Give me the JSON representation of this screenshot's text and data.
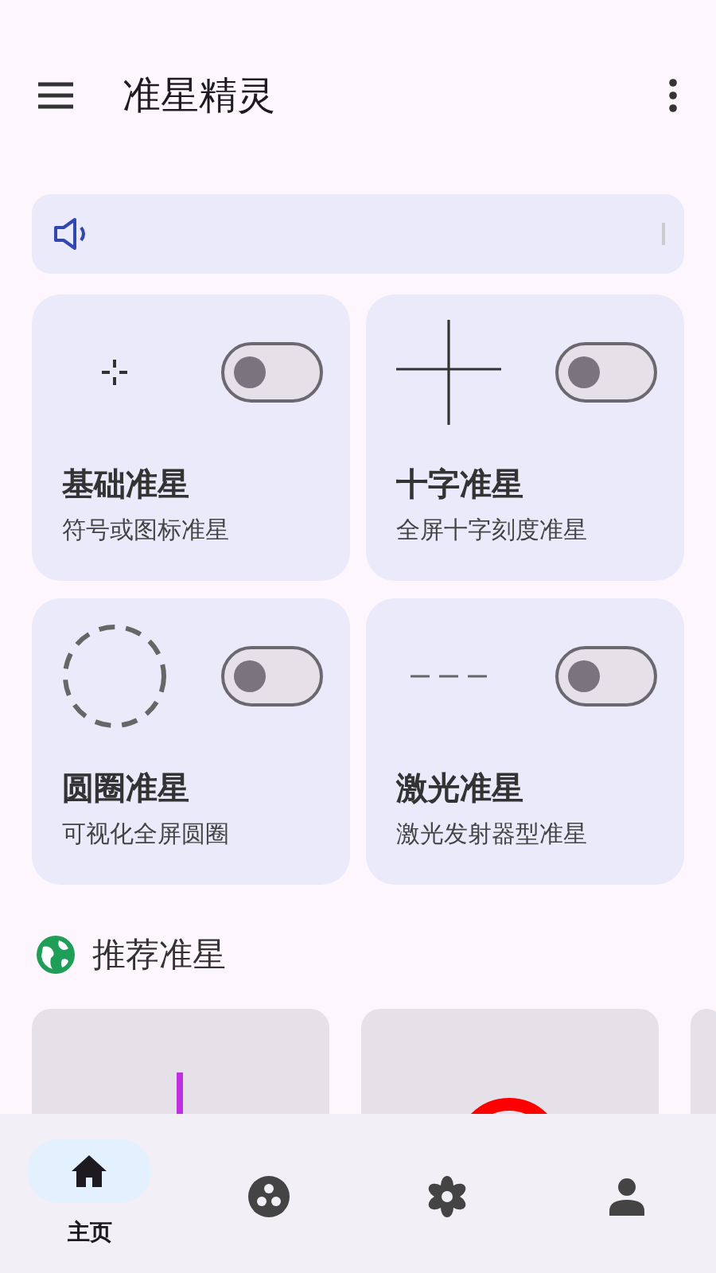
{
  "app_bar": {
    "title": "准星精灵"
  },
  "tiles": [
    {
      "kind": "dot",
      "title": "基础准星",
      "subtitle": "符号或图标准星",
      "on": false
    },
    {
      "kind": "cross",
      "title": "十字准星",
      "subtitle": "全屏十字刻度准星",
      "on": false
    },
    {
      "kind": "circle",
      "title": "圆圈准星",
      "subtitle": "可视化全屏圆圈",
      "on": false
    },
    {
      "kind": "laser",
      "title": "激光准星",
      "subtitle": "激光发射器型准星",
      "on": false
    }
  ],
  "recommended": {
    "title": "推荐准星"
  },
  "bottom_nav": [
    {
      "kind": "home",
      "label": "主页",
      "selected": true
    },
    {
      "kind": "dots",
      "selected": false
    },
    {
      "kind": "gear",
      "selected": false
    },
    {
      "kind": "person",
      "selected": false
    }
  ]
}
